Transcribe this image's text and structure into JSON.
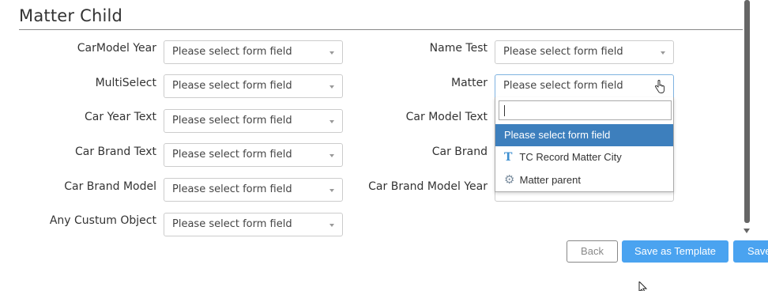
{
  "section": {
    "title": "Matter Child"
  },
  "placeholder": "Please select form field",
  "left_fields": [
    {
      "label": "CarModel Year",
      "value": "Please select form field"
    },
    {
      "label": "MultiSelect",
      "value": "Please select form field"
    },
    {
      "label": "Car Year Text",
      "value": "Please select form field"
    },
    {
      "label": "Car Brand Text",
      "value": "Please select form field"
    },
    {
      "label": "Car Brand Model",
      "value": "Please select form field"
    },
    {
      "label": "Any Custum Object",
      "value": "Please select form field"
    }
  ],
  "right_fields": [
    {
      "label": "Name Test",
      "value": "Please select form field"
    },
    {
      "label": "Matter",
      "value": "Please select form field"
    },
    {
      "label": "Car Model Text",
      "value": ""
    },
    {
      "label": "Car Brand",
      "value": ""
    },
    {
      "label": "Car Brand Model Year",
      "value": ""
    }
  ],
  "dropdown": {
    "search_value": "",
    "options": [
      {
        "label": "Please select form field",
        "icon": "",
        "highlighted": true
      },
      {
        "label": "TC Record Matter City",
        "icon": "text-type-icon",
        "highlighted": false
      },
      {
        "label": "Matter parent",
        "icon": "gear-icon",
        "highlighted": false
      }
    ]
  },
  "buttons": {
    "back": "Back",
    "save_template": "Save as Template",
    "save": "Save"
  },
  "colors": {
    "primary": "#4aa3f0",
    "highlight": "#3d7fbd",
    "icon_t": "#3d8fd0"
  }
}
